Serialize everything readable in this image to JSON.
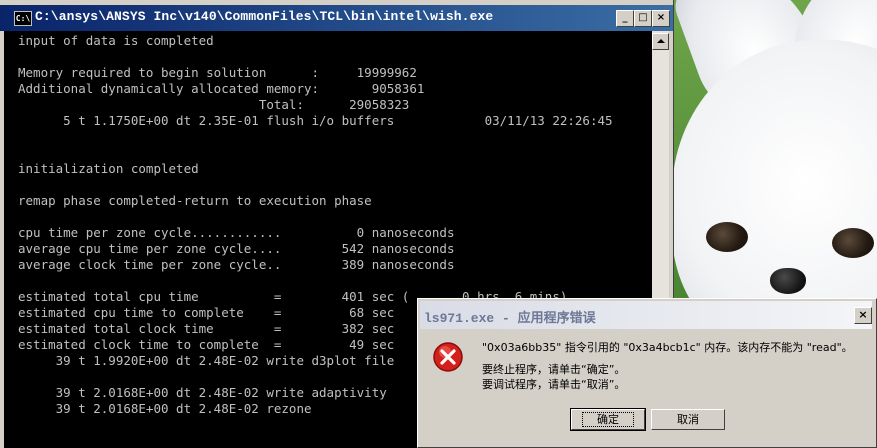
{
  "console": {
    "title": "C:\\ansys\\ANSYS Inc\\v140\\CommonFiles\\TCL\\bin\\intel\\wish.exe",
    "app_icon_text": "C:\\",
    "lines": [
      "input of data is completed",
      "",
      "Memory required to begin solution      :     19999962",
      "Additional dynamically allocated memory:       9058361",
      "                                Total:      29058323",
      "      5 t 1.1750E+00 dt 2.35E-01 flush i/o buffers            03/11/13 22:26:45",
      "",
      "",
      "initialization completed",
      "",
      "remap phase completed-return to execution phase",
      "",
      "cpu time per zone cycle............          0 nanoseconds",
      "average cpu time per zone cycle....        542 nanoseconds",
      "average clock time per zone cycle..        389 nanoseconds",
      "",
      "estimated total cpu time          =        401 sec (       0 hrs  6 mins)",
      "estimated cpu time to complete    =         68 sec",
      "estimated total clock time        =        382 sec",
      "estimated clock time to complete  =         49 sec",
      "     39 t 1.9920E+00 dt 2.48E-02 write d3plot file",
      "",
      "     39 t 2.0168E+00 dt 2.48E-02 write adaptivity",
      "     39 t 2.0168E+00 dt 2.48E-02 rezone"
    ]
  },
  "window_buttons": {
    "minimize": "_",
    "maximize": "□",
    "close": "×"
  },
  "dialog": {
    "title": "ls971.exe - 应用程序错误",
    "message_line1": "\"0x03a6bb35\" 指令引用的 \"0x3a4bcb1c\" 内存。该内存不能为 \"read\"。",
    "message_line2": "要终止程序，请单击“确定”。",
    "message_line3": "要调试程序，请单击“取消”。",
    "ok_label": "确定",
    "cancel_label": "取消",
    "close_glyph": "×"
  },
  "colors": {
    "titlebar_active_start": "#0a246a",
    "titlebar_active_end": "#3a6ea5",
    "console_bg": "#000000",
    "console_text": "#c0c0c0",
    "error_icon_red": "#d4201a"
  },
  "icons": [
    "console-app-icon",
    "error-icon",
    "scroll-up-arrow-icon"
  ]
}
